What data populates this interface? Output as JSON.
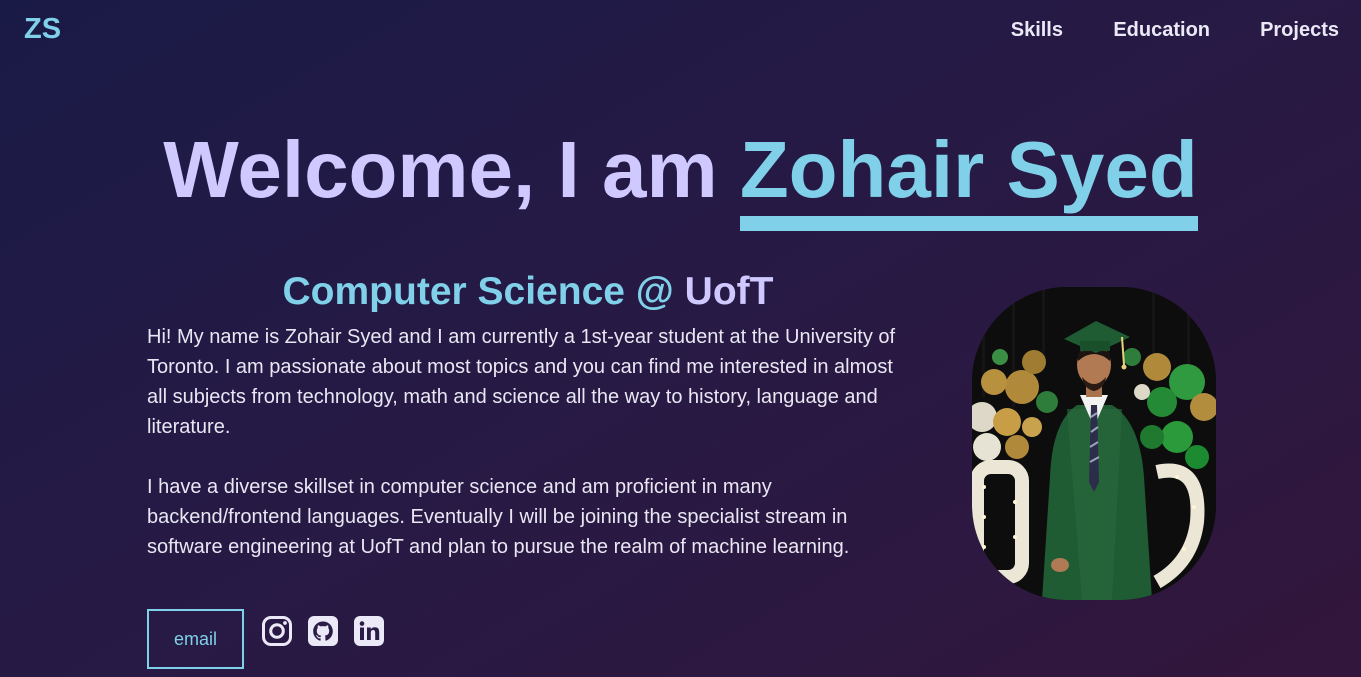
{
  "header": {
    "logo": "ZS",
    "nav": [
      {
        "label": "Skills"
      },
      {
        "label": "Education"
      },
      {
        "label": "Projects"
      }
    ]
  },
  "hero": {
    "greeting": "Welcome, I am ",
    "name": "Zohair Syed"
  },
  "about": {
    "subtitle_field": "Computer Science @ ",
    "subtitle_school": "UofT",
    "paragraphs": [
      "Hi! My name is Zohair Syed and I am currently a 1st-year student at the University of Toronto. I am passionate about most topics and you can find me interested in almost all subjects from technology, math and science all the way to history, language and literature.",
      "I have a diverse skillset in computer science and am proficient in many backend/frontend languages. Eventually I will be joining the specialist stream in software engineering at UofT and plan to pursue the realm of machine learning."
    ]
  },
  "contact": {
    "email_label": "email",
    "socials": [
      {
        "icon": "instagram-icon"
      },
      {
        "icon": "github-icon"
      },
      {
        "icon": "linkedin-icon"
      }
    ]
  },
  "colors": {
    "accent": "#7fd0e8",
    "heading": "#cfc9ff",
    "background_start": "#1a1a46",
    "background_end": "#33163b"
  }
}
